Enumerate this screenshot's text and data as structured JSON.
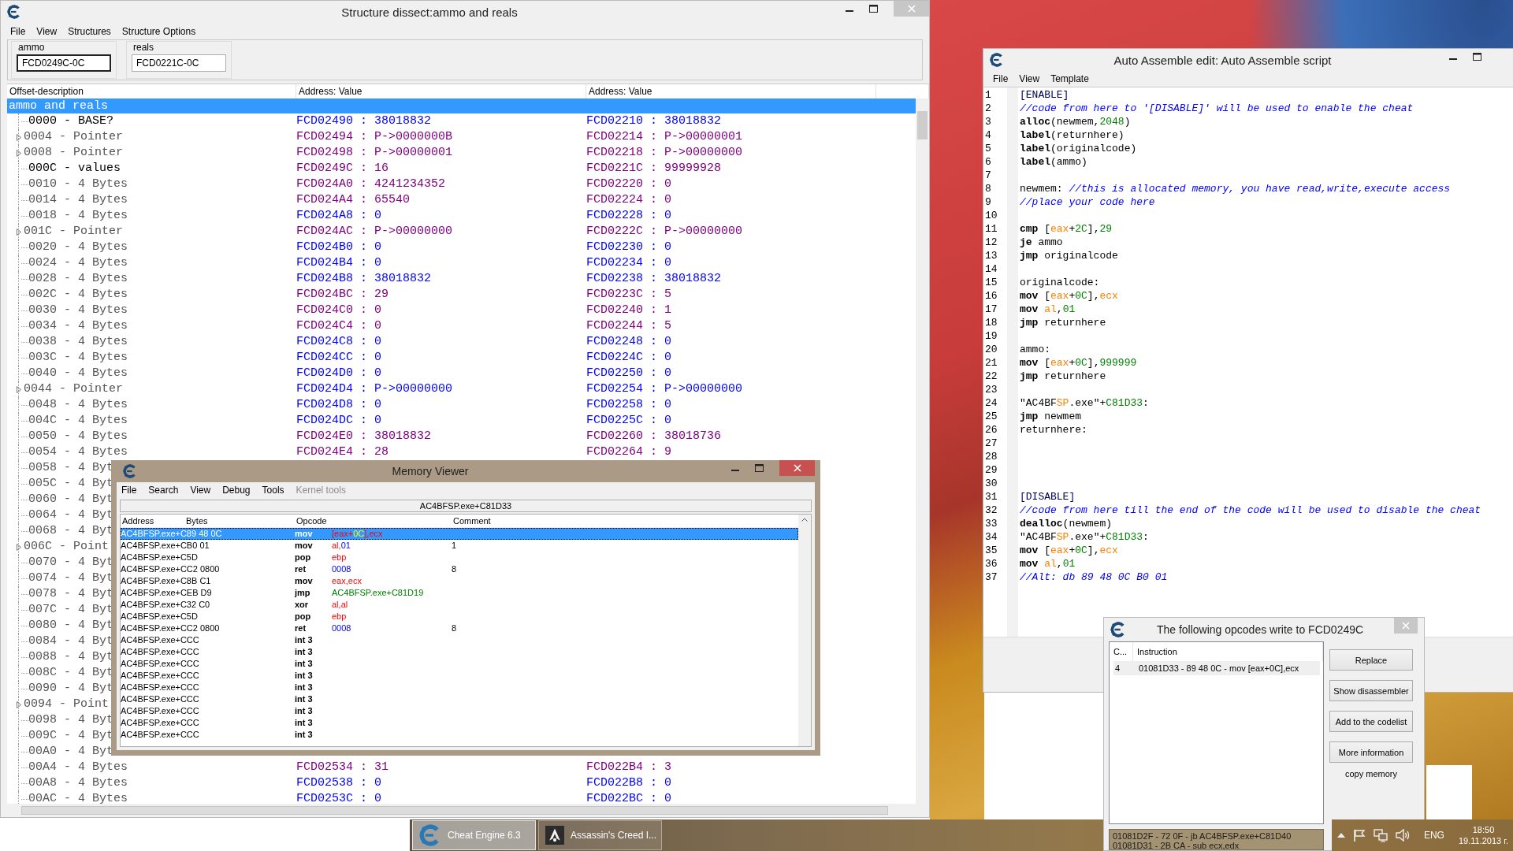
{
  "structure_window": {
    "title": "Structure dissect:ammo and reals",
    "menu": [
      "File",
      "View",
      "Structures",
      "Structure Options"
    ],
    "groups": [
      {
        "label": "ammo",
        "value": "FCD0249C-0C",
        "focused": true
      },
      {
        "label": "reals",
        "value": "FCD0221C-0C",
        "focused": false
      }
    ],
    "columns": [
      "Offset-description",
      "Address: Value",
      "Address: Value"
    ],
    "root": {
      "label": "ammo and reals",
      "selected": true
    },
    "rows": [
      {
        "description": "0000 - BASE?",
        "named": true,
        "expandable": false,
        "value_1": "FCD02490 : 38018832",
        "value_2": "FCD02210 : 38018832",
        "differs": false
      },
      {
        "description": "0004 - Pointer",
        "named": false,
        "expandable": true,
        "value_1": "FCD02494 : P->0000000B",
        "value_2": "FCD02214 : P->00000001",
        "differs": true
      },
      {
        "description": "0008 - Pointer",
        "named": false,
        "expandable": true,
        "value_1": "FCD02498 : P->00000001",
        "value_2": "FCD02218 : P->00000000",
        "differs": true
      },
      {
        "description": "000C - values",
        "named": true,
        "expandable": false,
        "value_1": "FCD0249C : 16",
        "value_2": "FCD0221C : 99999928",
        "differs": true
      },
      {
        "description": "0010 - 4 Bytes",
        "named": false,
        "expandable": false,
        "value_1": "FCD024A0 : 4241234352",
        "value_2": "FCD02220 : 0",
        "differs": true
      },
      {
        "description": "0014 - 4 Bytes",
        "named": false,
        "expandable": false,
        "value_1": "FCD024A4 : 65540",
        "value_2": "FCD02224 : 0",
        "differs": true
      },
      {
        "description": "0018 - 4 Bytes",
        "named": false,
        "expandable": false,
        "value_1": "FCD024A8 : 0",
        "value_2": "FCD02228 : 0",
        "differs": false
      },
      {
        "description": "001C - Pointer",
        "named": false,
        "expandable": true,
        "value_1": "FCD024AC : P->00000000",
        "value_2": "FCD0222C : P->00000000",
        "differs": true
      },
      {
        "description": "0020 - 4 Bytes",
        "named": false,
        "expandable": false,
        "value_1": "FCD024B0 : 0",
        "value_2": "FCD02230 : 0",
        "differs": false
      },
      {
        "description": "0024 - 4 Bytes",
        "named": false,
        "expandable": false,
        "value_1": "FCD024B4 : 0",
        "value_2": "FCD02234 : 0",
        "differs": false
      },
      {
        "description": "0028 - 4 Bytes",
        "named": false,
        "expandable": false,
        "value_1": "FCD024B8 : 38018832",
        "value_2": "FCD02238 : 38018832",
        "differs": false
      },
      {
        "description": "002C - 4 Bytes",
        "named": false,
        "expandable": false,
        "value_1": "FCD024BC : 29",
        "value_2": "FCD0223C : 5",
        "differs": true
      },
      {
        "description": "0030 - 4 Bytes",
        "named": false,
        "expandable": false,
        "value_1": "FCD024C0 : 0",
        "value_2": "FCD02240 : 1",
        "differs": true
      },
      {
        "description": "0034 - 4 Bytes",
        "named": false,
        "expandable": false,
        "value_1": "FCD024C4 : 0",
        "value_2": "FCD02244 : 5",
        "differs": true
      },
      {
        "description": "0038 - 4 Bytes",
        "named": false,
        "expandable": false,
        "value_1": "FCD024C8 : 0",
        "value_2": "FCD02248 : 0",
        "differs": false
      },
      {
        "description": "003C - 4 Bytes",
        "named": false,
        "expandable": false,
        "value_1": "FCD024CC : 0",
        "value_2": "FCD0224C : 0",
        "differs": false
      },
      {
        "description": "0040 - 4 Bytes",
        "named": false,
        "expandable": false,
        "value_1": "FCD024D0 : 0",
        "value_2": "FCD02250 : 0",
        "differs": false
      },
      {
        "description": "0044 - Pointer",
        "named": false,
        "expandable": true,
        "value_1": "FCD024D4 : P->00000000",
        "value_2": "FCD02254 : P->00000000",
        "differs": false
      },
      {
        "description": "0048 - 4 Bytes",
        "named": false,
        "expandable": false,
        "value_1": "FCD024D8 : 0",
        "value_2": "FCD02258 : 0",
        "differs": false
      },
      {
        "description": "004C - 4 Bytes",
        "named": false,
        "expandable": false,
        "value_1": "FCD024DC : 0",
        "value_2": "FCD0225C : 0",
        "differs": false
      },
      {
        "description": "0050 - 4 Bytes",
        "named": false,
        "expandable": false,
        "value_1": "FCD024E0 : 38018832",
        "value_2": "FCD02260 : 38018736",
        "differs": true
      },
      {
        "description": "0054 - 4 Bytes",
        "named": false,
        "expandable": false,
        "value_1": "FCD024E4 : 28",
        "value_2": "FCD02264 : 9",
        "differs": true
      },
      {
        "description": "0058 - 4 Byt",
        "named": false,
        "expandable": false
      },
      {
        "description": "005C - 4 Byt",
        "named": false,
        "expandable": false
      },
      {
        "description": "0060 - 4 Byt",
        "named": false,
        "expandable": false
      },
      {
        "description": "0064 - 4 Byt",
        "named": false,
        "expandable": false
      },
      {
        "description": "0068 - 4 Byt",
        "named": false,
        "expandable": false
      },
      {
        "description": "006C - Point",
        "named": false,
        "expandable": true
      },
      {
        "description": "0070 - 4 Byt",
        "named": false,
        "expandable": false
      },
      {
        "description": "0074 - 4 Byt",
        "named": false,
        "expandable": false
      },
      {
        "description": "0078 - 4 Byt",
        "named": false,
        "expandable": false
      },
      {
        "description": "007C - 4 Byt",
        "named": false,
        "expandable": false
      },
      {
        "description": "0080 - 4 Byt",
        "named": false,
        "expandable": false
      },
      {
        "description": "0084 - 4 Byt",
        "named": false,
        "expandable": false
      },
      {
        "description": "0088 - 4 Byt",
        "named": false,
        "expandable": false
      },
      {
        "description": "008C - 4 Byt",
        "named": false,
        "expandable": false
      },
      {
        "description": "0090 - 4 Byt",
        "named": false,
        "expandable": false
      },
      {
        "description": "0094 - Point",
        "named": false,
        "expandable": true
      },
      {
        "description": "0098 - 4 Byt",
        "named": false,
        "expandable": false
      },
      {
        "description": "009C - 4 Byt",
        "named": false,
        "expandable": false
      },
      {
        "description": "00A0 - 4 Byt",
        "named": false,
        "expandable": false
      },
      {
        "description": "00A4 - 4 Bytes",
        "named": false,
        "expandable": false,
        "value_1": "FCD02534 : 31",
        "value_2": "FCD022B4 : 3",
        "differs": true
      },
      {
        "description": "00A8 - 4 Bytes",
        "named": false,
        "expandable": false,
        "value_1": "FCD02538 : 0",
        "value_2": "FCD022B8 : 0",
        "differs": false
      },
      {
        "description": "00AC - 4 Bytes",
        "named": false,
        "expandable": false,
        "value_1": "FCD0253C : 0",
        "value_2": "FCD022BC : 0",
        "differs": false
      }
    ]
  },
  "memory_viewer": {
    "title": "Memory Viewer",
    "menu": [
      {
        "label": "File",
        "disabled": false
      },
      {
        "label": "Search",
        "disabled": false
      },
      {
        "label": "View",
        "disabled": false
      },
      {
        "label": "Debug",
        "disabled": false
      },
      {
        "label": "Tools",
        "disabled": false
      },
      {
        "label": "Kernel tools",
        "disabled": true
      }
    ],
    "address": "AC4BFSP.exe+C81D33",
    "columns": [
      "Address",
      "Bytes",
      "Opcode",
      "Comment"
    ],
    "rows": [
      {
        "address_bytes": "AC4BFSP.exe+C89 48 0C",
        "opcode": "mov",
        "operands": [
          {
            "kind": "punct",
            "text": "["
          },
          {
            "kind": "reg",
            "text": "eax"
          },
          {
            "kind": "punct",
            "text": "+"
          },
          {
            "kind": "num",
            "text": "0C"
          },
          {
            "kind": "punct",
            "text": "],"
          },
          {
            "kind": "reg",
            "text": "ecx"
          }
        ],
        "selected": true
      },
      {
        "address_bytes": "AC4BFSP.exe+CB0 01",
        "opcode": "mov",
        "operands": [
          {
            "kind": "reg",
            "text": "al"
          },
          {
            "kind": "punct",
            "text": ","
          },
          {
            "kind": "num",
            "text": "01"
          }
        ],
        "comment": "1",
        "selected": false
      },
      {
        "address_bytes": "AC4BFSP.exe+C5D",
        "opcode": "pop",
        "operands": [
          {
            "kind": "reg",
            "text": "ebp"
          }
        ],
        "selected": false
      },
      {
        "address_bytes": "AC4BFSP.exe+CC2 0800",
        "opcode": "ret",
        "operands": [
          {
            "kind": "num",
            "text": "0008"
          }
        ],
        "comment": "8",
        "selected": false
      },
      {
        "address_bytes": "AC4BFSP.exe+C8B C1",
        "opcode": "mov",
        "operands": [
          {
            "kind": "reg",
            "text": "eax"
          },
          {
            "kind": "punct",
            "text": ","
          },
          {
            "kind": "reg",
            "text": "ecx"
          }
        ],
        "selected": false
      },
      {
        "address_bytes": "AC4BFSP.exe+CEB D9",
        "opcode": "jmp",
        "operands": [
          {
            "kind": "addr",
            "text": "AC4BFSP.exe+C81D19"
          }
        ],
        "selected": false
      },
      {
        "address_bytes": "AC4BFSP.exe+C32 C0",
        "opcode": "xor",
        "operands": [
          {
            "kind": "reg",
            "text": "al"
          },
          {
            "kind": "punct",
            "text": ","
          },
          {
            "kind": "reg",
            "text": "al"
          }
        ],
        "selected": false
      },
      {
        "address_bytes": "AC4BFSP.exe+C5D",
        "opcode": "pop",
        "operands": [
          {
            "kind": "reg",
            "text": "ebp"
          }
        ],
        "selected": false
      },
      {
        "address_bytes": "AC4BFSP.exe+CC2 0800",
        "opcode": "ret",
        "operands": [
          {
            "kind": "num",
            "text": "0008"
          }
        ],
        "comment": "8",
        "selected": false
      },
      {
        "address_bytes": "AC4BFSP.exe+CCC",
        "opcode": "int 3",
        "selected": false
      },
      {
        "address_bytes": "AC4BFSP.exe+CCC",
        "opcode": "int 3",
        "selected": false
      },
      {
        "address_bytes": "AC4BFSP.exe+CCC",
        "opcode": "int 3",
        "selected": false
      },
      {
        "address_bytes": "AC4BFSP.exe+CCC",
        "opcode": "int 3",
        "selected": false
      },
      {
        "address_bytes": "AC4BFSP.exe+CCC",
        "opcode": "int 3",
        "selected": false
      },
      {
        "address_bytes": "AC4BFSP.exe+CCC",
        "opcode": "int 3",
        "selected": false
      },
      {
        "address_bytes": "AC4BFSP.exe+CCC",
        "opcode": "int 3",
        "selected": false
      },
      {
        "address_bytes": "AC4BFSP.exe+CCC",
        "opcode": "int 3",
        "selected": false
      },
      {
        "address_bytes": "AC4BFSP.exe+CCC",
        "opcode": "int 3",
        "selected": false
      }
    ]
  },
  "auto_assemble": {
    "title": "Auto Assemble edit: Auto Assemble script",
    "menu": [
      "File",
      "View",
      "Template"
    ],
    "lines": [
      {
        "number": "1",
        "parts": [
          {
            "kind": "section",
            "text": "[ENABLE]"
          }
        ]
      },
      {
        "number": "2",
        "parts": [
          {
            "kind": "comment",
            "text": "//code from here to '[DISABLE]' will be used to enable the cheat"
          }
        ]
      },
      {
        "number": "3",
        "parts": [
          {
            "kind": "kw",
            "text": "alloc"
          },
          {
            "kind": "text",
            "text": "(newmem,"
          },
          {
            "kind": "num",
            "text": "2048"
          },
          {
            "kind": "text",
            "text": ")"
          }
        ]
      },
      {
        "number": "4",
        "parts": [
          {
            "kind": "kw",
            "text": "label"
          },
          {
            "kind": "text",
            "text": "(returnhere)"
          }
        ]
      },
      {
        "number": "5",
        "parts": [
          {
            "kind": "kw",
            "text": "label"
          },
          {
            "kind": "text",
            "text": "(originalcode)"
          }
        ]
      },
      {
        "number": "6",
        "parts": [
          {
            "kind": "kw",
            "text": "label"
          },
          {
            "kind": "text",
            "text": "(ammo)"
          }
        ]
      },
      {
        "number": "7"
      },
      {
        "number": "8",
        "parts": [
          {
            "kind": "text",
            "text": "newmem: "
          },
          {
            "kind": "comment",
            "text": "//this is allocated memory, you have read,write,execute access"
          }
        ]
      },
      {
        "number": "9",
        "parts": [
          {
            "kind": "comment",
            "text": "//place your code here"
          }
        ]
      },
      {
        "number": "10"
      },
      {
        "number": "11",
        "parts": [
          {
            "kind": "kw",
            "text": "cmp"
          },
          {
            "kind": "text",
            "text": " ["
          },
          {
            "kind": "reg",
            "text": "eax"
          },
          {
            "kind": "text",
            "text": "+"
          },
          {
            "kind": "num",
            "text": "2C"
          },
          {
            "kind": "text",
            "text": "],"
          },
          {
            "kind": "num",
            "text": "29"
          }
        ]
      },
      {
        "number": "12",
        "parts": [
          {
            "kind": "kw",
            "text": "je"
          },
          {
            "kind": "text",
            "text": " ammo"
          }
        ]
      },
      {
        "number": "13",
        "parts": [
          {
            "kind": "kw",
            "text": "jmp"
          },
          {
            "kind": "text",
            "text": " originalcode"
          }
        ]
      },
      {
        "number": "14"
      },
      {
        "number": "15",
        "parts": [
          {
            "kind": "text",
            "text": "originalcode:"
          }
        ]
      },
      {
        "number": "16",
        "parts": [
          {
            "kind": "kw",
            "text": "mov"
          },
          {
            "kind": "text",
            "text": " ["
          },
          {
            "kind": "reg",
            "text": "eax"
          },
          {
            "kind": "text",
            "text": "+"
          },
          {
            "kind": "num",
            "text": "0C"
          },
          {
            "kind": "text",
            "text": "],"
          },
          {
            "kind": "reg",
            "text": "ecx"
          }
        ]
      },
      {
        "number": "17",
        "parts": [
          {
            "kind": "kw",
            "text": "mov"
          },
          {
            "kind": "reg",
            "text": " al"
          },
          {
            "kind": "text",
            "text": ","
          },
          {
            "kind": "num",
            "text": "01"
          }
        ]
      },
      {
        "number": "18",
        "parts": [
          {
            "kind": "kw",
            "text": "jmp"
          },
          {
            "kind": "text",
            "text": " returnhere"
          }
        ]
      },
      {
        "number": "19"
      },
      {
        "number": "20",
        "parts": [
          {
            "kind": "text",
            "text": "ammo:"
          }
        ]
      },
      {
        "number": "21",
        "parts": [
          {
            "kind": "kw",
            "text": "mov"
          },
          {
            "kind": "text",
            "text": " ["
          },
          {
            "kind": "reg",
            "text": "eax"
          },
          {
            "kind": "text",
            "text": "+"
          },
          {
            "kind": "num",
            "text": "0C"
          },
          {
            "kind": "text",
            "text": "],"
          },
          {
            "kind": "num",
            "text": "999999"
          }
        ]
      },
      {
        "number": "22",
        "parts": [
          {
            "kind": "kw",
            "text": "jmp"
          },
          {
            "kind": "text",
            "text": " returnhere"
          }
        ]
      },
      {
        "number": "23"
      },
      {
        "number": "24",
        "parts": [
          {
            "kind": "text",
            "text": "\"AC4BF"
          },
          {
            "kind": "reg",
            "text": "SP"
          },
          {
            "kind": "text",
            "text": ".exe\"+"
          },
          {
            "kind": "num",
            "text": "C81D33"
          },
          {
            "kind": "text",
            "text": ":"
          }
        ]
      },
      {
        "number": "25",
        "parts": [
          {
            "kind": "kw",
            "text": "jmp"
          },
          {
            "kind": "text",
            "text": " newmem"
          }
        ]
      },
      {
        "number": "26",
        "parts": [
          {
            "kind": "text",
            "text": "returnhere:"
          }
        ]
      },
      {
        "number": "27"
      },
      {
        "number": "28"
      },
      {
        "number": "29"
      },
      {
        "number": "30"
      },
      {
        "number": "31",
        "parts": [
          {
            "kind": "section",
            "text": "[DISABLE]"
          }
        ]
      },
      {
        "number": "32",
        "parts": [
          {
            "kind": "comment",
            "text": "//code from here till the end of the code will be used to disable the cheat"
          }
        ]
      },
      {
        "number": "33",
        "parts": [
          {
            "kind": "kw",
            "text": "dealloc"
          },
          {
            "kind": "text",
            "text": "(newmem)"
          }
        ]
      },
      {
        "number": "34",
        "parts": [
          {
            "kind": "text",
            "text": "\"AC4BF"
          },
          {
            "kind": "reg",
            "text": "SP"
          },
          {
            "kind": "text",
            "text": ".exe\"+"
          },
          {
            "kind": "num",
            "text": "C81D33"
          },
          {
            "kind": "text",
            "text": ":"
          }
        ]
      },
      {
        "number": "35",
        "parts": [
          {
            "kind": "kw",
            "text": "mov"
          },
          {
            "kind": "text",
            "text": " ["
          },
          {
            "kind": "reg",
            "text": "eax"
          },
          {
            "kind": "text",
            "text": "+"
          },
          {
            "kind": "num",
            "text": "0C"
          },
          {
            "kind": "text",
            "text": "],"
          },
          {
            "kind": "reg",
            "text": "ecx"
          }
        ]
      },
      {
        "number": "36",
        "parts": [
          {
            "kind": "kw",
            "text": "mov"
          },
          {
            "kind": "reg",
            "text": " al"
          },
          {
            "kind": "text",
            "text": ","
          },
          {
            "kind": "num",
            "text": "01"
          }
        ]
      },
      {
        "number": "37",
        "parts": [
          {
            "kind": "comment",
            "text": "//Alt: db 89 48 0C B0 01"
          }
        ]
      }
    ]
  },
  "opcode_dialog": {
    "title": "The following opcodes write to FCD0249C",
    "columns": [
      "C...",
      "Instruction"
    ],
    "rows": [
      {
        "count": "4",
        "instruction": "01081D33 - 89 48 0C - mov [eax+0C],ecx",
        "selected": true
      }
    ],
    "buttons": [
      "Replace",
      "Show disassembler",
      "Add to the codelist",
      "More information"
    ],
    "link": "copy memory",
    "details": [
      "01081D2F - 72 0F - jb AC4BFSP.exe+C81D40",
      "01081D31 - 2B CA - sub ecx,edx"
    ]
  },
  "taskbar": {
    "buttons": [
      {
        "label": "Cheat Engine 6.3",
        "kind": "cheat-engine",
        "active": true
      },
      {
        "label": "Assassin's Creed I...",
        "kind": "game",
        "active": false
      }
    ],
    "language": "ENG",
    "time": "18:50",
    "date": "19.11.2013 г."
  }
}
